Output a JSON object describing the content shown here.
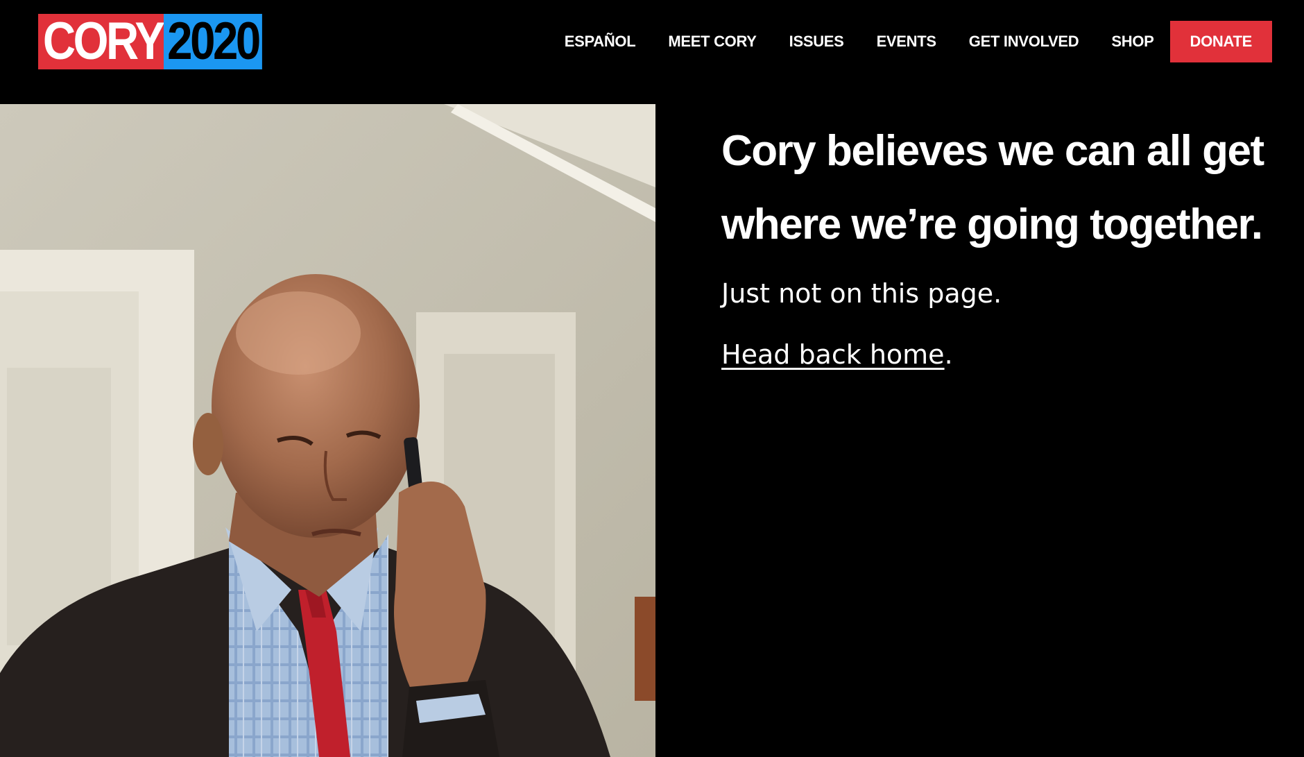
{
  "header": {
    "logo": {
      "part1": "CORY",
      "part2": "2020"
    },
    "nav": [
      {
        "label": "ESPAÑOL"
      },
      {
        "label": "MEET CORY"
      },
      {
        "label": "ISSUES"
      },
      {
        "label": "EVENTS"
      },
      {
        "label": "GET INVOLVED"
      },
      {
        "label": "SHOP"
      }
    ],
    "donate_label": "DONATE"
  },
  "main": {
    "headline": "Cory believes we can all get where we’re going together.",
    "subtext": "Just not on this page.",
    "home_link": "Head back home",
    "home_suffix": "."
  },
  "colors": {
    "background": "#000000",
    "brand_red": "#e1313a",
    "brand_blue": "#1b97f2",
    "text": "#ffffff"
  }
}
